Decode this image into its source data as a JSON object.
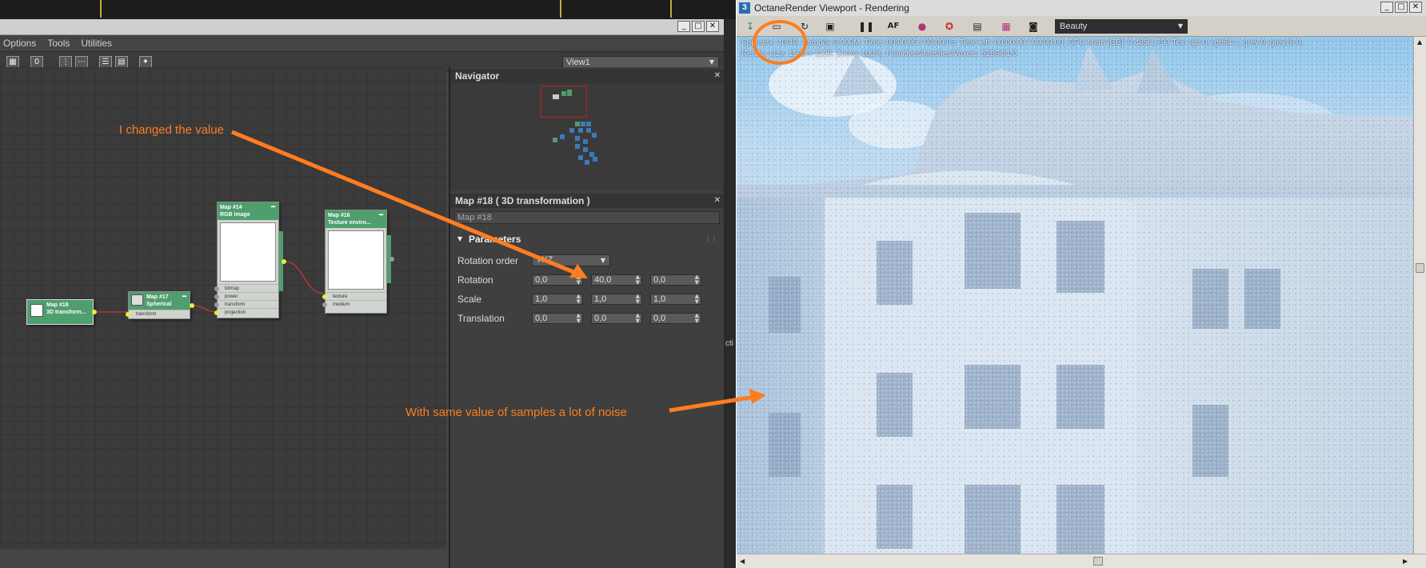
{
  "slate": {
    "menu": [
      "Options",
      "Tools",
      "Utilities"
    ],
    "toolbar": {
      "zero_label": "0"
    },
    "view_select": "View1"
  },
  "nodes": {
    "map18": {
      "title": "Map #18",
      "subtitle": "3D transform..."
    },
    "map17": {
      "title": "Map #17",
      "subtitle": "Spherical",
      "ports": [
        "transform"
      ]
    },
    "map14": {
      "title": "Map #14",
      "subtitle": "RGB image",
      "ports": [
        "bitmap",
        "power",
        "transform",
        "projection"
      ]
    },
    "map16": {
      "title": "Map #16",
      "subtitle": "Texture enviro...",
      "ports": [
        "texture",
        "medium"
      ]
    }
  },
  "navigator": {
    "title": "Navigator"
  },
  "params_panel": {
    "title": "Map #18  ( 3D transformation )",
    "name_value": "Map #18",
    "rollout": "Parameters",
    "rotation_order_label": "Rotation order",
    "rotation_order_value": "YXZ",
    "rows": [
      {
        "label": "Rotation",
        "values": [
          "0,0",
          "40,0",
          "0,0"
        ]
      },
      {
        "label": "Scale",
        "values": [
          "1,0",
          "1,0",
          "1,0"
        ]
      },
      {
        "label": "Translation",
        "values": [
          "0,0",
          "0,0",
          "0,0"
        ]
      }
    ]
  },
  "octane": {
    "title": "OctaneRender Viewport - Rendering",
    "logo": "3",
    "pass_select": "Beauty",
    "status_line1": "Spp/max: 40/40.   Samp/s: 0.000M.   Time: 00:00:05 / 00:00:05.   Time left: 00:00:00 / 00:00:00.   GPU Mem [GB]: 0.485/1.793   Tex: rgb 0, rgb64 1, grey 0, grey16 0.",
    "status_line2": "Render size: 1500 x 1125.   Zoom: 100%.   Primitives/Meshes/Voxels: 52864/1/0",
    "icons": [
      "render-icon",
      "save-icon",
      "restart-icon",
      "lock-icon",
      "pause-icon",
      "af-icon",
      "color-icon",
      "lifebuoy-icon",
      "region-icon",
      "film-icon",
      "camera-icon"
    ]
  },
  "annotations": {
    "changed_value": "I changed the value",
    "noise_note": "With same value of samples a lot of noise",
    "accent_color": "#ff7d1e"
  },
  "clipped_text": "cti"
}
